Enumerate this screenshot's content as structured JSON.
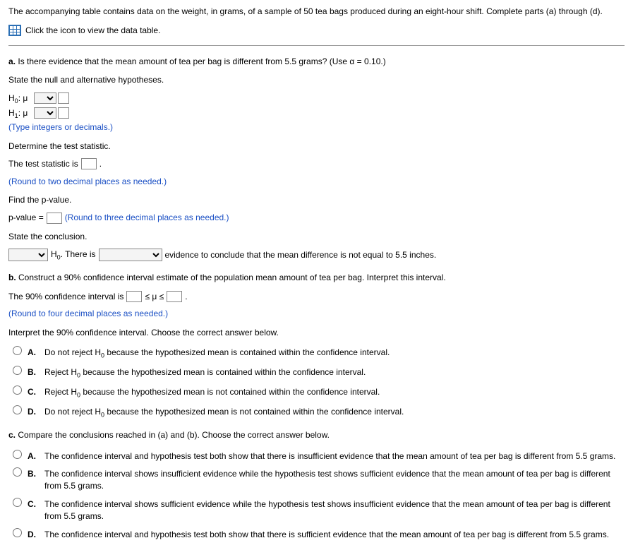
{
  "intro": "The accompanying table contains data on the weight, in grams, of a sample of 50 tea bags produced during an eight-hour shift. Complete parts (a) through (d).",
  "dataLink": "Click the icon to view the data table.",
  "partA": {
    "question": "Is there evidence that the mean amount of tea per bag is different from 5.5 grams? (Use α = 0.10.)",
    "stateHyp": "State the null and alternative hypotheses.",
    "h0": "H",
    "h0sub": "0",
    "h1": "H",
    "h1sub": "1",
    "mu": ": μ",
    "hypNote": "(Type integers or decimals.)",
    "detStat": "Determine the test statistic.",
    "testStatPre": "The test statistic is",
    "testStatPost": ".",
    "roundTwo": "(Round to two decimal places as needed.)",
    "findP": "Find the p-value.",
    "pvalPre": "p-value =",
    "roundThree": "(Round to three decimal places as needed.)",
    "stateConc": "State the conclusion.",
    "concMid1": "H",
    "concMid1sub": "0",
    "concMid2": ". There is",
    "concEnd": "evidence to conclude that the mean difference is not equal to 5.5 inches."
  },
  "partB": {
    "question": "Construct a 90% confidence interval estimate of the population mean amount of tea per bag. Interpret this interval.",
    "ciPre": "The 90% confidence interval is",
    "ciMid": "≤ μ ≤",
    "ciPost": ".",
    "roundFour": "(Round to four decimal places as needed.)",
    "interpret": "Interpret the 90% confidence interval. Choose the correct answer below.",
    "options": [
      {
        "letter": "A.",
        "pre": "Do not reject H",
        "sub": "0",
        "post": " because the hypothesized mean is contained within the confidence interval."
      },
      {
        "letter": "B.",
        "pre": "Reject H",
        "sub": "0",
        "post": " because the hypothesized mean is contained within the confidence interval."
      },
      {
        "letter": "C.",
        "pre": "Reject H",
        "sub": "0",
        "post": " because the hypothesized mean is not contained within the confidence interval."
      },
      {
        "letter": "D.",
        "pre": "Do not reject H",
        "sub": "0",
        "post": " because the hypothesized mean is not contained within the confidence interval."
      }
    ]
  },
  "partC": {
    "question": "Compare the conclusions reached in (a) and (b). Choose the correct answer below.",
    "options": [
      {
        "letter": "A.",
        "text": "The confidence interval and hypothesis test both show that there is insufficient evidence that the mean amount of tea per bag is different from 5.5 grams."
      },
      {
        "letter": "B.",
        "text": "The confidence interval shows insufficient evidence while the hypothesis test shows sufficient evidence that the mean amount of tea per bag is different from 5.5 grams."
      },
      {
        "letter": "C.",
        "text": "The confidence interval shows sufficient evidence while the hypothesis test shows insufficient evidence that the mean amount of tea per bag is different from 5.5 grams."
      },
      {
        "letter": "D.",
        "text": "The confidence interval and hypothesis test both show that there is sufficient evidence that the mean amount of tea per bag is different from 5.5 grams."
      }
    ]
  }
}
